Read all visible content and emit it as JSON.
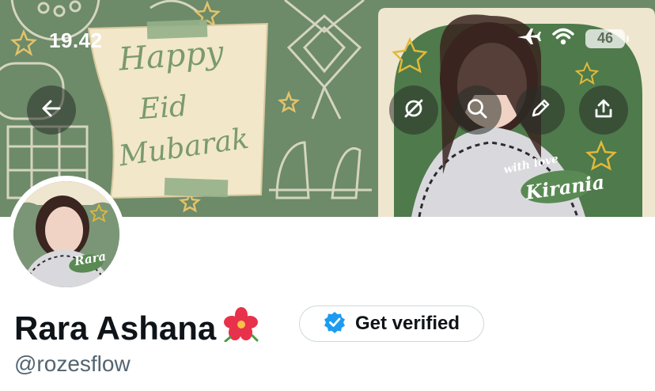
{
  "status_bar": {
    "time": "19.42",
    "battery": "46"
  },
  "banner": {
    "card_lines": [
      "Happy",
      "Eid",
      "Mubarak"
    ],
    "sticker_top": "with love",
    "sticker_name": "Kirania"
  },
  "avatar": {
    "sticker": "Rara"
  },
  "profile": {
    "display_name": "Rara Ashana",
    "flower_emoji": "🌺",
    "handle": "@rozesflow",
    "verify_label": "Get verified"
  },
  "colors": {
    "banner_green": "#6d8a69",
    "verify_badge": "#1d9bf0",
    "handle_gray": "#536471"
  }
}
